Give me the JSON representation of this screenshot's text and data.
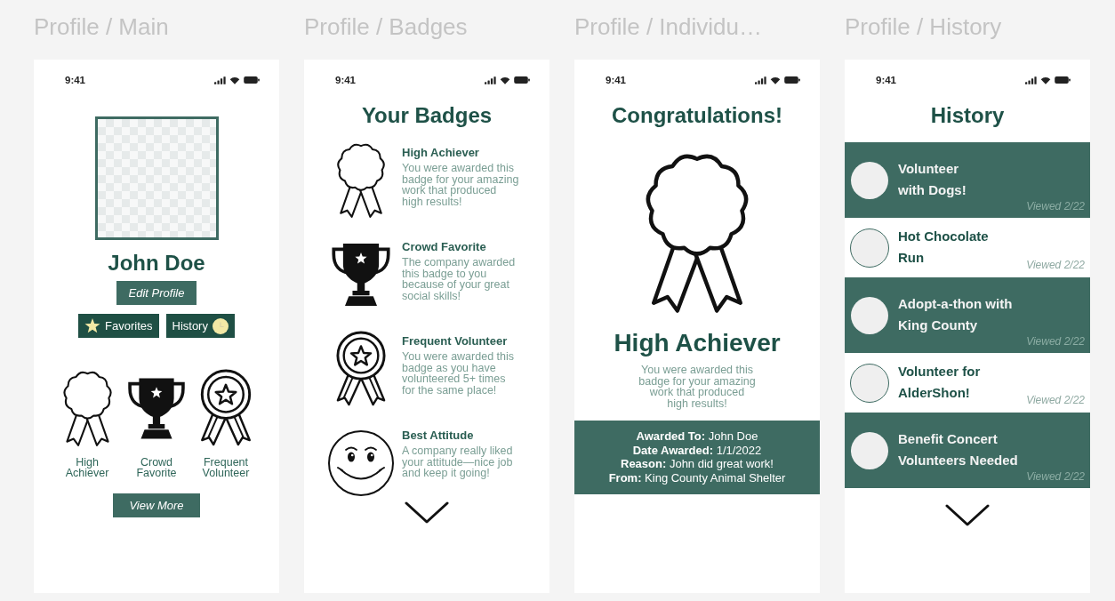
{
  "frames": [
    {
      "kind": "main",
      "title": "Profile / Main",
      "status_bar": {
        "time": "9:41"
      },
      "profile_name": "John Doe",
      "edit_button": "Edit Profile",
      "nav_buttons": [
        {
          "kind": "star",
          "label": "Favorites"
        },
        {
          "kind": "clock",
          "label": "History"
        }
      ],
      "badges": [
        {
          "kind": "rosette",
          "name": "High Achiever"
        },
        {
          "kind": "trophy",
          "name": "Crowd Favorite"
        },
        {
          "kind": "medal",
          "name": "Frequent Volunteer"
        }
      ],
      "more_button": "View More"
    },
    {
      "kind": "badges",
      "title": "Profile / Badges",
      "status_bar": {
        "time": "9:41"
      },
      "heading": "Your Badges",
      "badges": [
        {
          "kind": "rosette",
          "name": "High Achiever",
          "description": "You were awarded this\nbadge for your amazing\nwork that produced\nhigh results!"
        },
        {
          "kind": "trophy",
          "name": "Crowd Favorite",
          "description": "The company awarded\nthis badge to you\nbecause of your great\nsocial skills!"
        },
        {
          "kind": "medal",
          "name": "Frequent Volunteer",
          "description": "You were awarded this\nbadge as you have\nvolunteered 5+ times\nfor the same place!"
        },
        {
          "kind": "smiley",
          "name": "Best Attitude",
          "description": "A company really liked\nyour attitude—nice job\nand keep it going!"
        }
      ]
    },
    {
      "kind": "badge_detail",
      "title": "Profile / Individu…",
      "status_bar": {
        "time": "9:41"
      },
      "heading": "Congratulations!",
      "badge": {
        "kind": "rosette",
        "name": "High Achiever",
        "description": "You were awarded this\nbadge for your amazing\nwork that produced\nhigh results!"
      },
      "details": [
        "**Awarded To:** John Doe",
        "**Date Awarded:** 1/1/2022",
        "**Reason:** John did great work!",
        "**From:** King County Animal Shelter"
      ]
    },
    {
      "kind": "history",
      "title": "Profile / History",
      "status_bar": {
        "time": "9:41"
      },
      "heading": "History",
      "items": [
        {
          "title": "Volunteer\nwith Dogs!",
          "viewed": "Viewed 2/22",
          "highlighted": true
        },
        {
          "title": "Hot Chocolate\nRun",
          "viewed": "Viewed 2/22",
          "highlighted": false
        },
        {
          "title": "Adopt-a-thon with\nKing County",
          "viewed": "Viewed 2/22",
          "highlighted": true
        },
        {
          "title": "Volunteer for\nAlderShon!",
          "viewed": "Viewed 2/22",
          "highlighted": false
        },
        {
          "title": "Benefit Concert\nVolunteers Needed",
          "viewed": "Viewed 2/22",
          "highlighted": true
        }
      ]
    }
  ]
}
